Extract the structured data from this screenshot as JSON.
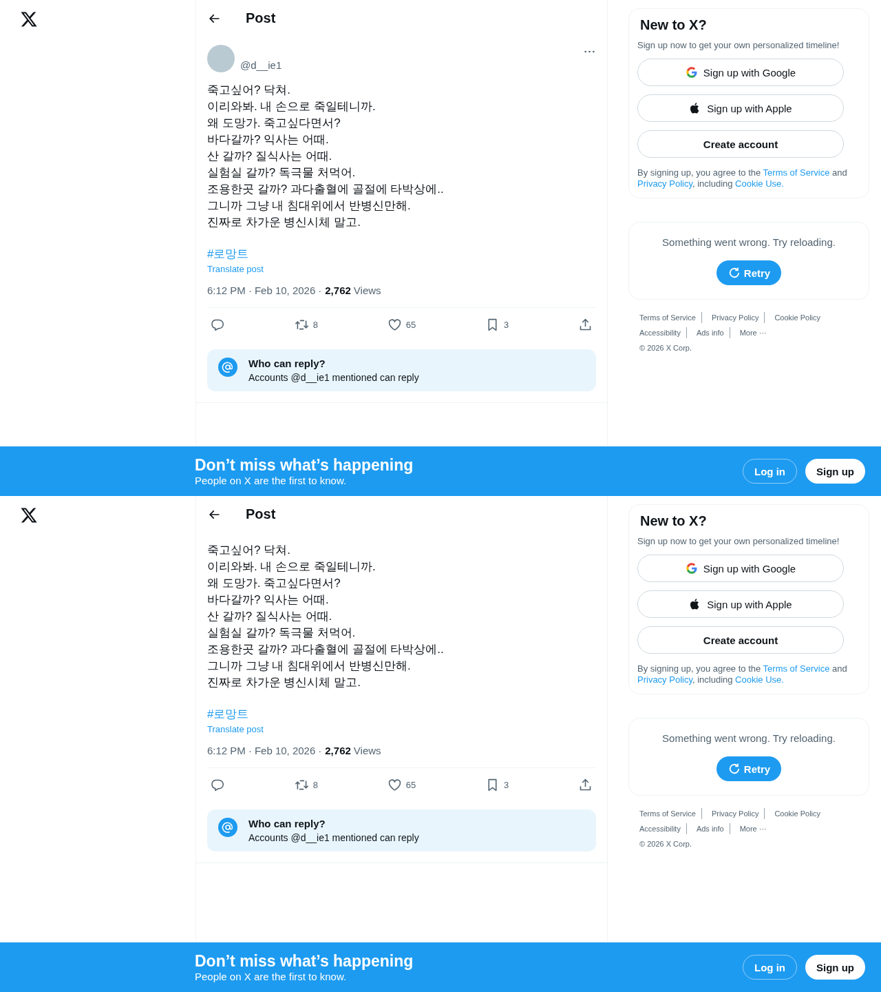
{
  "views": [
    {
      "header": {
        "title": "Post"
      },
      "post": {
        "author": {
          "handle": "@d__ie1"
        },
        "lines": [
          "죽고싶어? 닥쳐.",
          "이리와봐. 내 손으로 죽일테니까.",
          "왜 도망가. 죽고싶다면서?",
          "바다갈까? 익사는 어때.",
          "산 갈까? 질식사는 어때.",
          "실험실 갈까? 독극물 처먹어.",
          "조용한곳 갈까? 과다출혈에 골절에 타박상에..",
          "그니까 그냥 내 침대위에서 반병신만해.",
          "진짜로 차가운 병신시체 말고."
        ],
        "hashtag": "#로망트",
        "translate": "Translate post",
        "time": "6:12 PM",
        "sep1": "·",
        "date": "Feb 10, 2026",
        "sep2": "·",
        "views_count": "2,762",
        "views_label": "Views",
        "actions": [
          {
            "kind": "reply"
          },
          {
            "kind": "repost",
            "count": "8"
          },
          {
            "kind": "like",
            "count": "65"
          },
          {
            "kind": "bookmark",
            "count": "3"
          },
          {
            "kind": "share"
          }
        ],
        "reply_notice": {
          "title": "Who can reply?",
          "text": "Accounts @d__ie1 mentioned can reply"
        }
      },
      "signup": {
        "title": "New to X?",
        "subtitle": "Sign up now to get your own personalized timeline!",
        "buttons": [
          {
            "kind": "google",
            "label": "Sign up with Google"
          },
          {
            "kind": "apple",
            "label": "Sign up with Apple"
          },
          {
            "kind": "create",
            "label": "Create account"
          }
        ],
        "legal": "By signing up, you agree to the",
        "terms": "Terms of Service",
        "and": "and",
        "privacy": "Privacy Policy",
        "including": ", including",
        "cookie": "Cookie Use."
      },
      "error": {
        "message": "Something went wrong. Try reloading.",
        "retry": "Retry"
      },
      "footer": [
        "Terms of Service",
        "Privacy Policy",
        "Cookie Policy",
        "Accessibility",
        "Ads info",
        "More ···",
        "© 2026 X Corp."
      ],
      "banner": {
        "title": "Don’t miss what’s happening",
        "subtitle": "People on X are the first to know.",
        "login": "Log in",
        "signup": "Sign up"
      }
    },
    {
      "header": {
        "title": "Post"
      },
      "post": {
        "lines": [
          "죽고싶어? 닥쳐.",
          "이리와봐. 내 손으로 죽일테니까.",
          "왜 도망가. 죽고싶다면서?",
          "바다갈까? 익사는 어때.",
          "산 갈까? 질식사는 어때.",
          "실험실 갈까? 독극물 처먹어.",
          "조용한곳 갈까? 과다출혈에 골절에 타박상에..",
          "그니까 그냥 내 침대위에서 반병신만해.",
          "진짜로 차가운 병신시체 말고."
        ],
        "hashtag": "#로망트",
        "translate": "Translate post",
        "time": "6:12 PM",
        "sep1": "·",
        "date": "Feb 10, 2026",
        "sep2": "·",
        "views_count": "2,762",
        "views_label": "Views",
        "actions": [
          {
            "kind": "reply"
          },
          {
            "kind": "repost",
            "count": "8"
          },
          {
            "kind": "like",
            "count": "65"
          },
          {
            "kind": "bookmark",
            "count": "3"
          },
          {
            "kind": "share"
          }
        ],
        "reply_notice": {
          "title": "Who can reply?",
          "text": "Accounts @d__ie1 mentioned can reply"
        }
      },
      "signup": {
        "title": "New to X?",
        "subtitle": "Sign up now to get your own personalized timeline!",
        "buttons": [
          {
            "kind": "google",
            "label": "Sign up with Google"
          },
          {
            "kind": "apple",
            "label": "Sign up with Apple"
          },
          {
            "kind": "create",
            "label": "Create account"
          }
        ],
        "legal": "By signing up, you agree to the",
        "terms": "Terms of Service",
        "and": "and",
        "privacy": "Privacy Policy",
        "including": ", including",
        "cookie": "Cookie Use."
      },
      "error": {
        "message": "Something went wrong. Try reloading.",
        "retry": "Retry"
      },
      "footer": [
        "Terms of Service",
        "Privacy Policy",
        "Cookie Policy",
        "Accessibility",
        "Ads info",
        "More ···",
        "© 2026 X Corp."
      ],
      "banner": {
        "title": "Don’t miss what’s happening",
        "subtitle": "People on X are the first to know.",
        "login": "Log in",
        "signup": "Sign up"
      }
    }
  ]
}
